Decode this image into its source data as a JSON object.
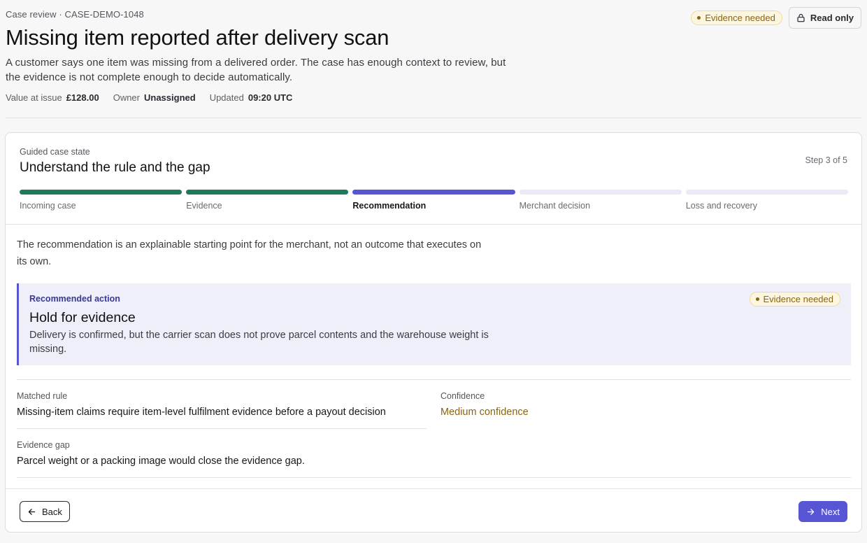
{
  "header": {
    "eyebrow": "Case review · CASE-DEMO-1048",
    "title": "Missing item reported after delivery scan",
    "description": "A customer says one item was missing from a delivered order. The case has enough context to review, but the evidence is not complete enough to decide automatically.",
    "meta": {
      "value_label": "Value at issue",
      "value": "£128.00",
      "owner_label": "Owner",
      "owner": "Unassigned",
      "updated_label": "Updated",
      "updated": "09:20 UTC"
    },
    "status_badge": "Evidence needed",
    "read_only_label": "Read only"
  },
  "guided": {
    "label": "Guided case state",
    "title": "Understand the rule and the gap",
    "step_count": "Step 3 of 5",
    "current_step": 3,
    "total_steps": 5,
    "steps": [
      {
        "label": "Incoming case",
        "state": "done"
      },
      {
        "label": "Evidence",
        "state": "done"
      },
      {
        "label": "Recommendation",
        "state": "current"
      },
      {
        "label": "Merchant decision",
        "state": "upcoming"
      },
      {
        "label": "Loss and recovery",
        "state": "upcoming"
      }
    ]
  },
  "intro": "The recommendation is an explainable starting point for the merchant, not an outcome that executes on its own.",
  "recommendation": {
    "label": "Recommended action",
    "title": "Hold for evidence",
    "description": "Delivery is confirmed, but the carrier scan does not prove parcel contents and the warehouse weight is missing.",
    "badge": "Evidence needed"
  },
  "fields": {
    "rule_label": "Matched rule",
    "rule_value": "Missing-item claims require item-level fulfilment evidence before a payout decision",
    "confidence_label": "Confidence",
    "confidence_value": "Medium confidence",
    "gap_label": "Evidence gap",
    "gap_value": "Parcel weight or a packing image would close the evidence gap."
  },
  "footer": {
    "back_label": "Back",
    "next_label": "Next"
  },
  "colors": {
    "accent": "#5755d4",
    "done": "#1f7a5c",
    "warning_text": "#8a6410",
    "warning_bg": "#fdf6df"
  },
  "icons": {
    "read_only": "lock-icon",
    "back": "arrow-left-icon",
    "next": "arrow-right-icon"
  }
}
